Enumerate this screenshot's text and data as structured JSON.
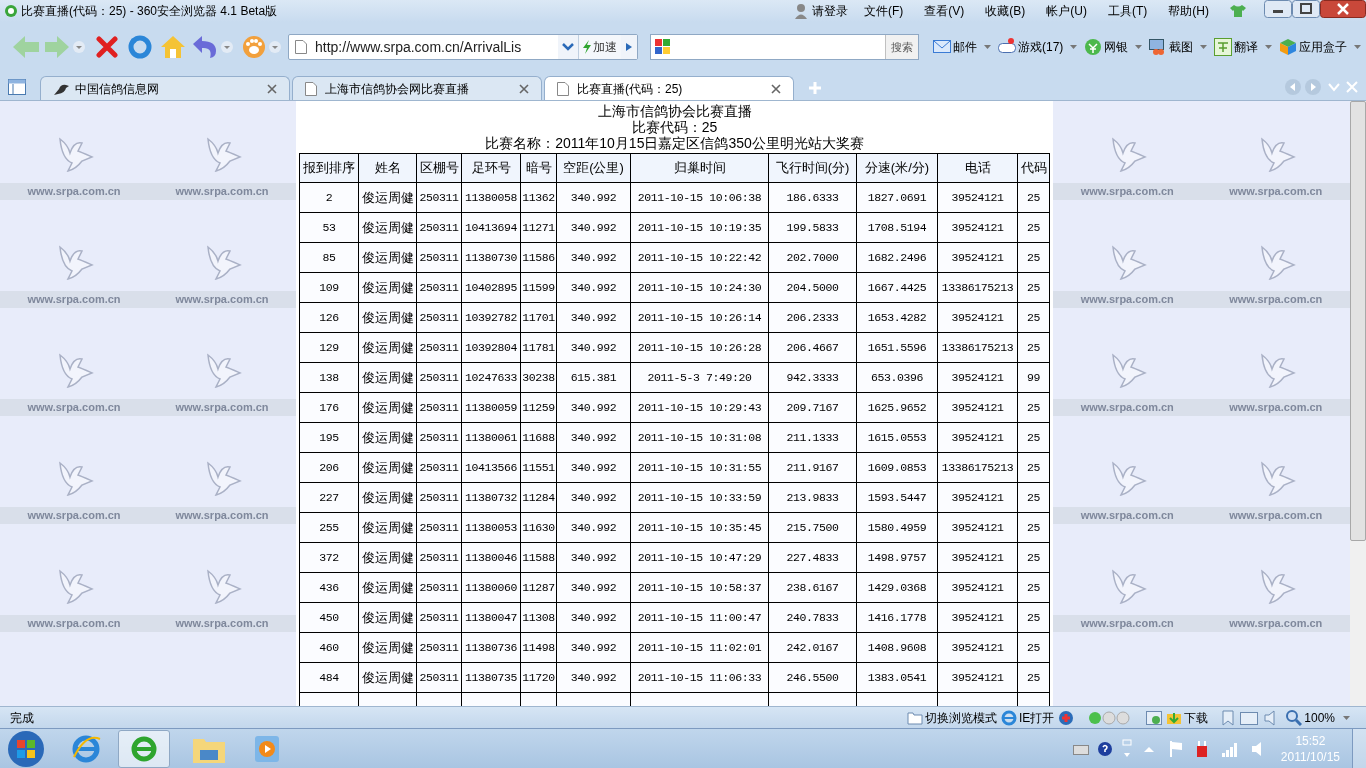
{
  "window": {
    "title": "比赛直播(代码：25) - 360安全浏览器 4.1 Beta版"
  },
  "login": "请登录",
  "menu": [
    "文件(F)",
    "查看(V)",
    "收藏(B)",
    "帐户(U)",
    "工具(T)",
    "帮助(H)"
  ],
  "address": {
    "url": "http://www.srpa.com.cn/ArrivalLis",
    "speedup": "加速"
  },
  "search": {
    "button": "搜索"
  },
  "toolbar_items": [
    {
      "label": "邮件",
      "kind": "mail"
    },
    {
      "label": "游戏(17)",
      "kind": "game"
    },
    {
      "label": "网银",
      "kind": "bank"
    },
    {
      "label": "截图",
      "kind": "capture"
    },
    {
      "label": "翻译",
      "kind": "translate"
    },
    {
      "label": "应用盒子",
      "kind": "apps"
    }
  ],
  "tabs": [
    {
      "label": "中国信鸽信息网",
      "selected": false,
      "kind": "bird"
    },
    {
      "label": "上海市信鸽协会网比赛直播",
      "selected": false,
      "kind": "page"
    },
    {
      "label": "比赛直播(代码：25)",
      "selected": true,
      "kind": "page"
    }
  ],
  "background": {
    "left": [
      "www.srpa.com.cn",
      "www.srpa.com.cn",
      "www.srpa.com.cn",
      "www.srpa.com.cn",
      "www.srpa.com.cn",
      "www.srpa.com.cn",
      "www.srpa.com.cn",
      "www.srpa.com.cn",
      "www.srpa.com.cn",
      "www.srpa.com.cn"
    ],
    "right": [
      "www.srpa.com.cn",
      "www.srpa.com.cn",
      "www.srpa.com.cn",
      "www.srpa.com.cn",
      "www.srpa.com.cn",
      "www.srpa.com.cn",
      "www.srpa.com.cn",
      "www.srpa.com.cn",
      "www.srpa.com.cn",
      "www.srpa.com.cn"
    ]
  },
  "page": {
    "heading": "上海市信鸽协会比赛直播",
    "code_line": "比赛代码：25",
    "name_line": "比赛名称：2011年10月15日嘉定区信鸽350公里明光站大奖赛"
  },
  "table": {
    "columns": [
      "报到排序",
      "姓名",
      "区棚号",
      "足环号",
      "暗号",
      "空距(公里)",
      "归巢时间",
      "飞行时间(分)",
      "分速(米/分)",
      "电话",
      "代码"
    ],
    "rows": [
      [
        "2",
        "俊运周健",
        "250311",
        "11380058",
        "11362",
        "340.992",
        "2011-10-15 10:06:38",
        "186.6333",
        "1827.0691",
        "39524121",
        "25"
      ],
      [
        "53",
        "俊运周健",
        "250311",
        "10413694",
        "11271",
        "340.992",
        "2011-10-15 10:19:35",
        "199.5833",
        "1708.5194",
        "39524121",
        "25"
      ],
      [
        "85",
        "俊运周健",
        "250311",
        "11380730",
        "11586",
        "340.992",
        "2011-10-15 10:22:42",
        "202.7000",
        "1682.2496",
        "39524121",
        "25"
      ],
      [
        "109",
        "俊运周健",
        "250311",
        "10402895",
        "11599",
        "340.992",
        "2011-10-15 10:24:30",
        "204.5000",
        "1667.4425",
        "13386175213",
        "25"
      ],
      [
        "126",
        "俊运周健",
        "250311",
        "10392782",
        "11701",
        "340.992",
        "2011-10-15 10:26:14",
        "206.2333",
        "1653.4282",
        "39524121",
        "25"
      ],
      [
        "129",
        "俊运周健",
        "250311",
        "10392804",
        "11781",
        "340.992",
        "2011-10-15 10:26:28",
        "206.4667",
        "1651.5596",
        "13386175213",
        "25"
      ],
      [
        "138",
        "俊运周健",
        "250311",
        "10247633",
        "30238",
        "615.381",
        "2011-5-3 7:49:20",
        "942.3333",
        "653.0396",
        "39524121",
        "99"
      ],
      [
        "176",
        "俊运周健",
        "250311",
        "11380059",
        "11259",
        "340.992",
        "2011-10-15 10:29:43",
        "209.7167",
        "1625.9652",
        "39524121",
        "25"
      ],
      [
        "195",
        "俊运周健",
        "250311",
        "11380061",
        "11688",
        "340.992",
        "2011-10-15 10:31:08",
        "211.1333",
        "1615.0553",
        "39524121",
        "25"
      ],
      [
        "206",
        "俊运周健",
        "250311",
        "10413566",
        "11551",
        "340.992",
        "2011-10-15 10:31:55",
        "211.9167",
        "1609.0853",
        "13386175213",
        "25"
      ],
      [
        "227",
        "俊运周健",
        "250311",
        "11380732",
        "11284",
        "340.992",
        "2011-10-15 10:33:59",
        "213.9833",
        "1593.5447",
        "39524121",
        "25"
      ],
      [
        "255",
        "俊运周健",
        "250311",
        "11380053",
        "11630",
        "340.992",
        "2011-10-15 10:35:45",
        "215.7500",
        "1580.4959",
        "39524121",
        "25"
      ],
      [
        "372",
        "俊运周健",
        "250311",
        "11380046",
        "11588",
        "340.992",
        "2011-10-15 10:47:29",
        "227.4833",
        "1498.9757",
        "39524121",
        "25"
      ],
      [
        "436",
        "俊运周健",
        "250311",
        "11380060",
        "11287",
        "340.992",
        "2011-10-15 10:58:37",
        "238.6167",
        "1429.0368",
        "39524121",
        "25"
      ],
      [
        "450",
        "俊运周健",
        "250311",
        "11380047",
        "11308",
        "340.992",
        "2011-10-15 11:00:47",
        "240.7833",
        "1416.1778",
        "39524121",
        "25"
      ],
      [
        "460",
        "俊运周健",
        "250311",
        "11380736",
        "11498",
        "340.992",
        "2011-10-15 11:02:01",
        "242.0167",
        "1408.9608",
        "39524121",
        "25"
      ],
      [
        "484",
        "俊运周健",
        "250311",
        "11380735",
        "11720",
        "340.992",
        "2011-10-15 11:06:33",
        "246.5500",
        "1383.0541",
        "39524121",
        "25"
      ]
    ]
  },
  "status_bar": {
    "text": "完成",
    "items": [
      {
        "label": "切换浏览模式",
        "kind": "folder"
      },
      {
        "label": "IE打开",
        "kind": "ie"
      },
      {
        "label": "下载",
        "kind": "download"
      }
    ],
    "zoom": "100%"
  },
  "taskbar": {
    "time": "15:52",
    "date": "2011/10/15"
  }
}
